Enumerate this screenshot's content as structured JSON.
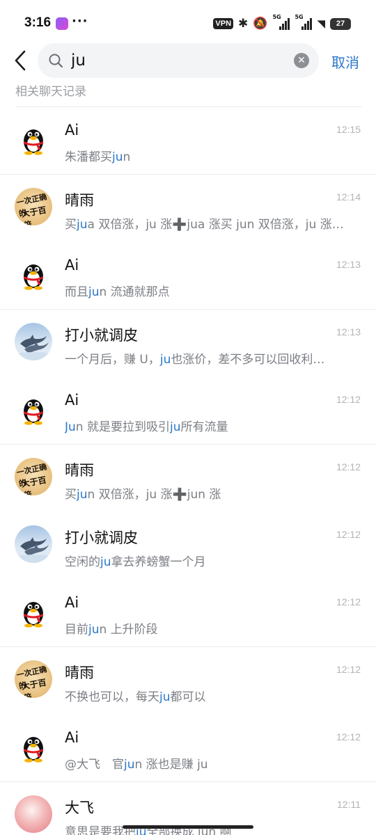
{
  "status_bar": {
    "time": "3:16",
    "dots": "···",
    "vpn": "VPN",
    "sig1": "5G",
    "sig2": "5G",
    "battery": "27"
  },
  "search": {
    "query": "ju",
    "cancel_label": "取消",
    "clear_symbol": "✕"
  },
  "section": {
    "title": "相关聊天记录"
  },
  "icons": {
    "back": "chevron-left-icon",
    "search": "search-icon",
    "clear": "clear-icon",
    "avatar_qq": "qq-penguin-avatar",
    "avatar_calli": "calligraphy-avatar",
    "avatar_dolphin": "dolphin-avatar"
  },
  "colors": {
    "accent": "#2a77c9",
    "time": "#b1b3b7",
    "snippet": "#7b7e84"
  },
  "results": [
    {
      "name": "Ai",
      "time": "12:15",
      "avatar": "qq",
      "snippet": [
        [
          "朱潘都买",
          0
        ],
        [
          "ju",
          1
        ],
        [
          "n",
          0
        ]
      ]
    },
    {
      "name": "晴雨",
      "time": "12:14",
      "avatar": "calli",
      "snippet": [
        [
          "买",
          0
        ],
        [
          "ju",
          1
        ],
        [
          "a 双倍涨，ju 涨➕jua 涨买 jun 双倍涨，ju 涨…",
          0
        ]
      ]
    },
    {
      "name": "Ai",
      "time": "12:13",
      "avatar": "qq",
      "snippet": [
        [
          "而且",
          0
        ],
        [
          "ju",
          1
        ],
        [
          "n 流通就那点",
          0
        ]
      ]
    },
    {
      "name": "打小就调皮",
      "time": "12:13",
      "avatar": "dolphin",
      "snippet": [
        [
          "一个月后，赚 U，",
          0
        ],
        [
          "ju",
          1
        ],
        [
          "也涨价，差不多可以回收利…",
          0
        ]
      ]
    },
    {
      "name": "Ai",
      "time": "12:12",
      "avatar": "qq",
      "snippet": [
        [
          "Ju",
          1
        ],
        [
          "n 就是要拉到吸引",
          0
        ],
        [
          "ju",
          1
        ],
        [
          "所有流量",
          0
        ]
      ]
    },
    {
      "name": "晴雨",
      "time": "12:12",
      "avatar": "calli",
      "snippet": [
        [
          "买",
          0
        ],
        [
          "ju",
          1
        ],
        [
          "n 双倍涨，ju 涨➕jun 涨",
          0
        ]
      ]
    },
    {
      "name": "打小就调皮",
      "time": "12:12",
      "avatar": "dolphin",
      "snippet": [
        [
          "空闲的",
          0
        ],
        [
          "ju",
          1
        ],
        [
          "拿去养螃蟹一个月",
          0
        ]
      ]
    },
    {
      "name": "Ai",
      "time": "12:12",
      "avatar": "qq",
      "snippet": [
        [
          "目前",
          0
        ],
        [
          "ju",
          1
        ],
        [
          "n 上升阶段",
          0
        ]
      ]
    },
    {
      "name": "晴雨",
      "time": "12:12",
      "avatar": "calli",
      "snippet": [
        [
          "不换也可以，每天",
          0
        ],
        [
          "ju",
          1
        ],
        [
          "都可以",
          0
        ]
      ]
    },
    {
      "name": "Ai",
      "time": "12:12",
      "avatar": "qq",
      "snippet": [
        [
          "@大飞　官",
          0
        ],
        [
          "ju",
          1
        ],
        [
          "n 涨也是赚 ju",
          0
        ]
      ]
    },
    {
      "name": "大飞",
      "time": "12:11",
      "avatar": "pink",
      "snippet": [
        [
          "意思是要我把",
          0
        ],
        [
          "ju",
          1
        ],
        [
          "全部换成 jun 啊",
          0
        ]
      ]
    }
  ]
}
